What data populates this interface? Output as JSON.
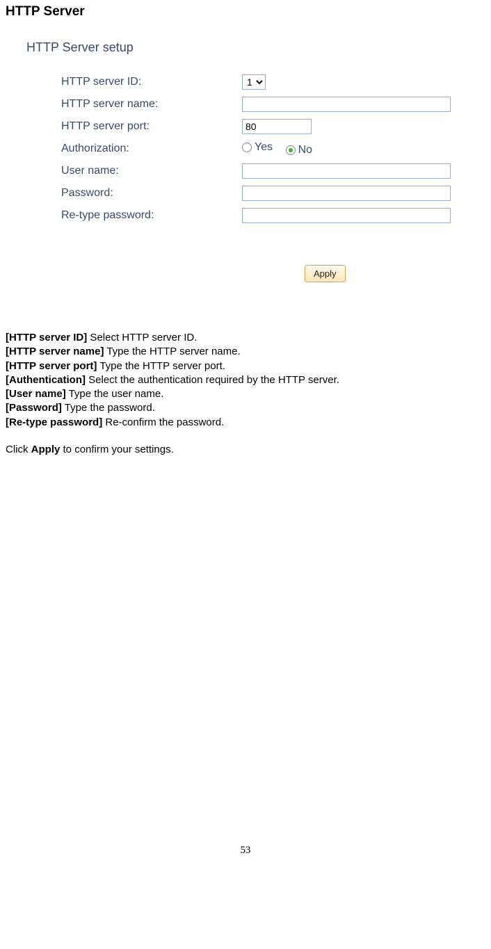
{
  "page_title": "HTTP Server",
  "screenshot": {
    "heading": "HTTP Server setup",
    "labels": {
      "server_id": "HTTP server ID:",
      "server_name": "HTTP server name:",
      "server_port": "HTTP server port:",
      "authorization": "Authorization:",
      "user_name": "User name:",
      "password": "Password:",
      "retype_password": "Re-type password:"
    },
    "values": {
      "server_id": "1",
      "server_name": "",
      "server_port": "80",
      "authorization_yes_label": "Yes",
      "authorization_no_label": "No",
      "authorization_selected": "no",
      "user_name": "",
      "password": "",
      "retype_password": ""
    },
    "apply_label": "Apply"
  },
  "descriptions": [
    {
      "label": "[HTTP server ID]",
      "text": " Select HTTP server ID."
    },
    {
      "label": "[HTTP server name]",
      "text": " Type the HTTP server name."
    },
    {
      "label": "[HTTP server port]",
      "text": " Type the HTTP server port."
    },
    {
      "label": "[Authentication]",
      "text": " Select the authentication required by the HTTP server."
    },
    {
      "label": "[User name]",
      "text": " Type the user name."
    },
    {
      "label": "[Password]",
      "text": " Type the password."
    },
    {
      "label": "[Re-type password]",
      "text": " Re-confirm the password."
    }
  ],
  "closing": {
    "prefix": "Click ",
    "bold": "Apply",
    "suffix": " to confirm your settings."
  },
  "page_number": "53"
}
